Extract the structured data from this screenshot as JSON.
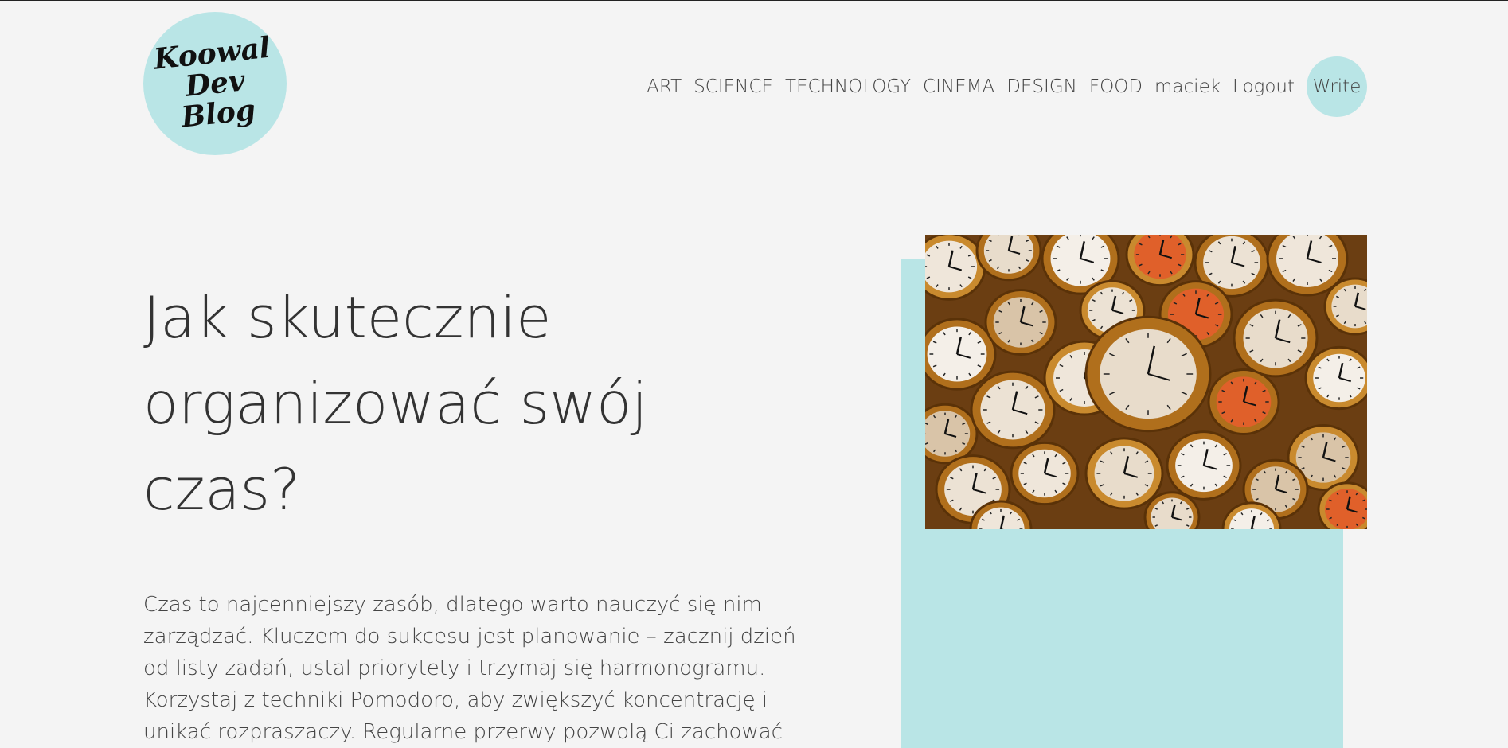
{
  "logo": {
    "text": "Koowal\nDev\nBlog"
  },
  "nav": {
    "categories": [
      "ART",
      "SCIENCE",
      "TECHNOLOGY",
      "CINEMA",
      "DESIGN",
      "FOOD"
    ],
    "username": "maciek",
    "logout_label": "Logout",
    "write_label": "Write"
  },
  "post": {
    "title": "Jak skutecznie organizować swój czas?",
    "description": "Czas to najcenniejszy zasób, dlatego warto nauczyć się nim zarządzać. Kluczem do sukcesu jest planowanie – zacznij dzień od listy zadań, ustal priorytety i trzymaj się harmonogramu. Korzystaj z techniki Pomodoro, aby zwiększyć koncentrację i unikać rozpraszaczy. Regularne przerwy pozwolą Ci zachować",
    "image_subject": "melting-clocks-image"
  },
  "colors": {
    "accent": "#b9e5e6",
    "background": "#f4f4f4",
    "text": "#333333"
  }
}
